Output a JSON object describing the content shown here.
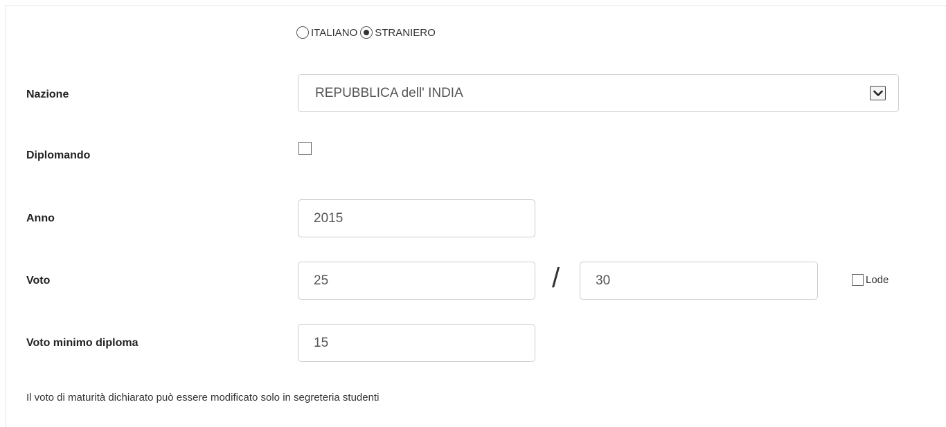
{
  "cittadinanza": {
    "options": [
      {
        "label": "ITALIANO",
        "selected": false
      },
      {
        "label": "STRANIERO",
        "selected": true
      }
    ]
  },
  "nazione": {
    "label": "Nazione",
    "value": "REPUBBLICA dell' INDIA"
  },
  "diplomando": {
    "label": "Diplomando",
    "checked": false
  },
  "anno": {
    "label": "Anno",
    "value": "2015"
  },
  "voto": {
    "label": "Voto",
    "value": "25",
    "separator": "/",
    "max_value": "30",
    "lode_label": "Lode",
    "lode_checked": false
  },
  "voto_minimo": {
    "label": "Voto minimo diploma",
    "value": "15"
  },
  "note": "Il voto di maturità dichiarato può essere modificato solo in segreteria studenti",
  "icons": {
    "select_arrow": "chevron-down-icon"
  }
}
